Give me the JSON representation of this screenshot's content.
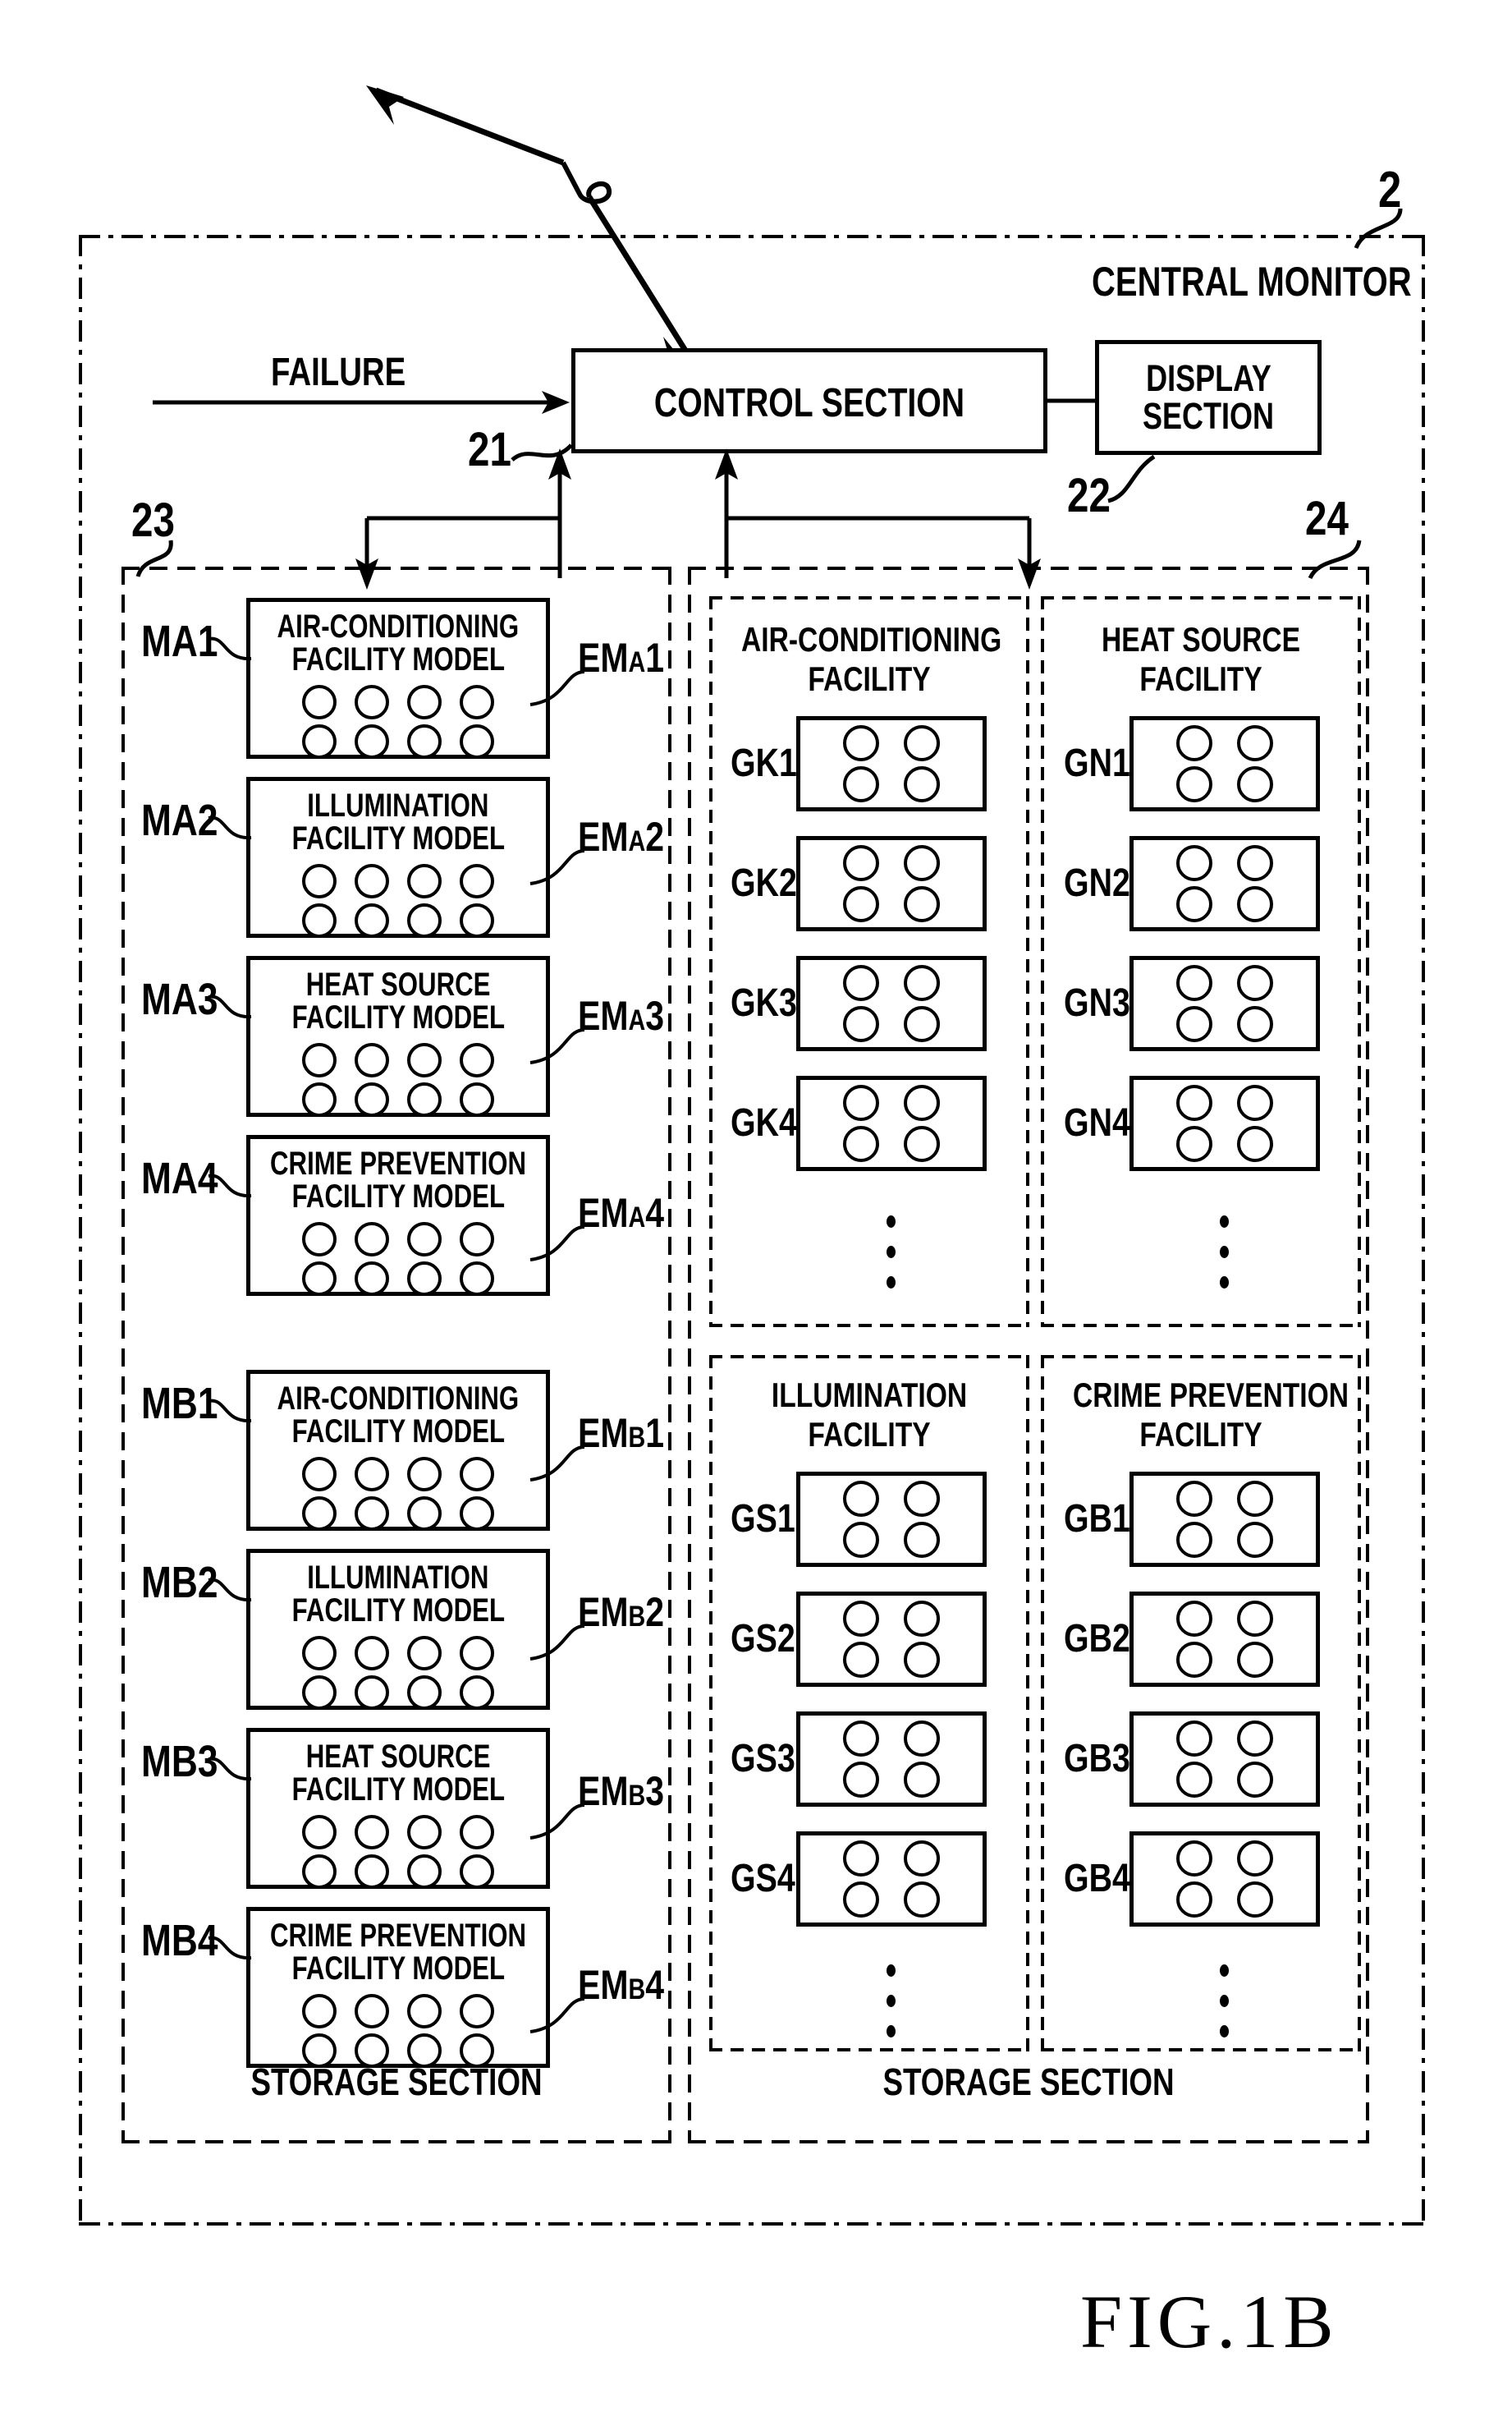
{
  "figure": {
    "caption": "FIG.1B",
    "outer_ref": "2",
    "outer_title": "CENTRAL MONITOR"
  },
  "header": {
    "failure_label": "FAILURE",
    "control_section": {
      "label": "CONTROL SECTION",
      "ref": "21"
    },
    "display_section": {
      "label": "DISPLAY SECTION",
      "line1": "DISPLAY",
      "line2": "SECTION",
      "ref": "22"
    }
  },
  "left_storage": {
    "ref": "23",
    "footer_label": "STORAGE SECTION",
    "groups": [
      {
        "models": [
          {
            "id": "MA1",
            "elem": "EM",
            "elem_sub": "A",
            "elem_num": "1",
            "line1": "AIR-CONDITIONING",
            "line2": "FACILITY MODEL",
            "circles": 8
          },
          {
            "id": "MA2",
            "elem": "EM",
            "elem_sub": "A",
            "elem_num": "2",
            "line1": "ILLUMINATION",
            "line2": "FACILITY MODEL",
            "circles": 8
          },
          {
            "id": "MA3",
            "elem": "EM",
            "elem_sub": "A",
            "elem_num": "3",
            "line1": "HEAT SOURCE",
            "line2": "FACILITY MODEL",
            "circles": 8
          },
          {
            "id": "MA4",
            "elem": "EM",
            "elem_sub": "A",
            "elem_num": "4",
            "line1": "CRIME PREVENTION",
            "line2": "FACILITY MODEL",
            "circles": 8
          }
        ]
      },
      {
        "models": [
          {
            "id": "MB1",
            "elem": "EM",
            "elem_sub": "B",
            "elem_num": "1",
            "line1": "AIR-CONDITIONING",
            "line2": "FACILITY MODEL",
            "circles": 8
          },
          {
            "id": "MB2",
            "elem": "EM",
            "elem_sub": "B",
            "elem_num": "2",
            "line1": "ILLUMINATION",
            "line2": "FACILITY MODEL",
            "circles": 8
          },
          {
            "id": "MB3",
            "elem": "EM",
            "elem_sub": "B",
            "elem_num": "3",
            "line1": "HEAT SOURCE",
            "line2": "FACILITY MODEL",
            "circles": 8
          },
          {
            "id": "MB4",
            "elem": "EM",
            "elem_sub": "B",
            "elem_num": "4",
            "line1": "CRIME PREVENTION",
            "line2": "FACILITY MODEL",
            "circles": 8
          }
        ]
      }
    ]
  },
  "right_storage": {
    "ref": "24",
    "footer_label": "STORAGE SECTION",
    "panels": [
      {
        "name": "air-conditioning-facility",
        "title_line1": "AIR-CONDITIONING",
        "title_line2": "FACILITY",
        "items": [
          "GK1",
          "GK2",
          "GK3",
          "GK4"
        ],
        "ellipsis": true,
        "circles_per_item": 4
      },
      {
        "name": "heat-source-facility",
        "title_line1": "HEAT SOURCE",
        "title_line2": "FACILITY",
        "items": [
          "GN1",
          "GN2",
          "GN3",
          "GN4"
        ],
        "ellipsis": true,
        "circles_per_item": 4
      },
      {
        "name": "illumination-facility",
        "title_line1": "ILLUMINATION",
        "title_line2": "FACILITY",
        "items": [
          "GS1",
          "GS2",
          "GS3",
          "GS4"
        ],
        "ellipsis": true,
        "circles_per_item": 4
      },
      {
        "name": "crime-prevention-facility",
        "title_line1": "CRIME PREVENTION",
        "title_line2": "FACILITY",
        "items": [
          "GB1",
          "GB2",
          "GB3",
          "GB4"
        ],
        "ellipsis": true,
        "circles_per_item": 4
      }
    ]
  },
  "colors": {
    "ink": "#000000",
    "paper": "#ffffff"
  }
}
